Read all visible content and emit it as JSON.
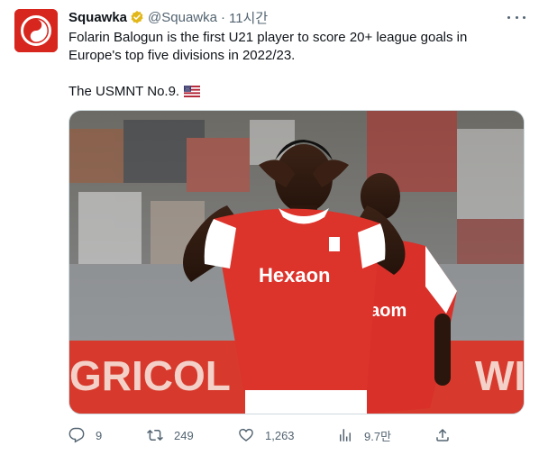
{
  "tweet": {
    "display_name": "Squawka",
    "handle": "@Squawka",
    "separator": "·",
    "time": "11시간",
    "text_line1": "Folarin Balogun is the first U21 player to score 20+ league goals in Europe's top five divisions in 2022/23.",
    "text_line2": "The USMNT No.9.",
    "flag_icon": "us-flag-icon",
    "media": {
      "shirt_sponsor": "HexaOn",
      "shirt_sponsor_display": "Hexaon",
      "second_shirt_sponsor_display": "xaom",
      "board_text": "GRICOL",
      "board_text_right": "WI"
    }
  },
  "actions": {
    "reply_count": "9",
    "retweet_count": "249",
    "like_count": "1,263",
    "views_count": "9.7만"
  },
  "colors": {
    "brand_red": "#d7261e",
    "text_primary": "#0f1419",
    "text_secondary": "#536471",
    "verified_gold": "#e2b719"
  }
}
